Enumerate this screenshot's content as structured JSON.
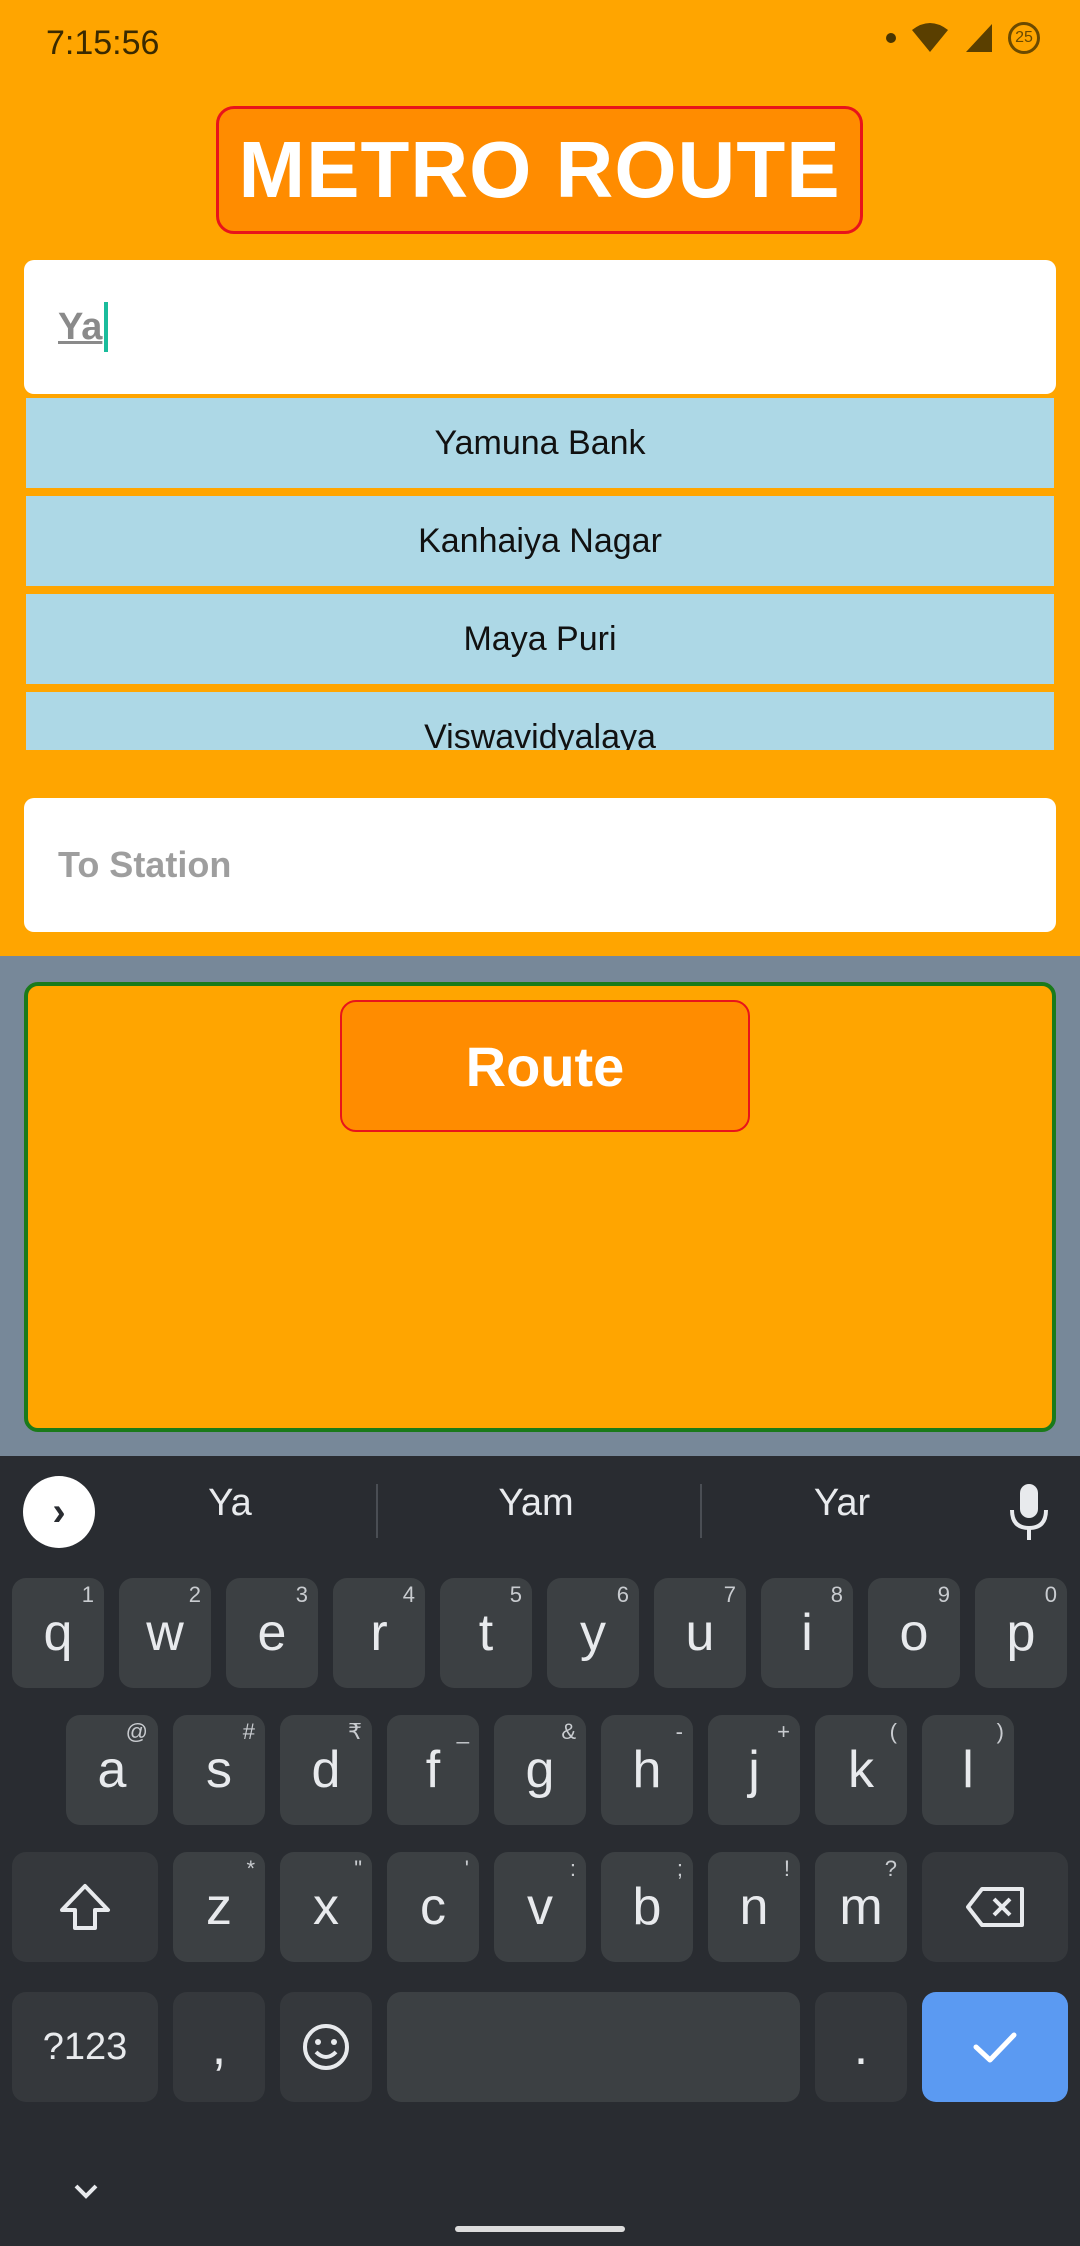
{
  "status": {
    "time": "7:15:56",
    "battery": "25"
  },
  "header": {
    "title": "METRO ROUTE"
  },
  "from_field": {
    "value": "Ya"
  },
  "suggestions": [
    "Yamuna Bank",
    "Kanhaiya Nagar",
    "Maya Puri",
    "Viswavidyalaya"
  ],
  "to_field": {
    "placeholder": "To Station"
  },
  "route_button": {
    "label": "Route"
  },
  "keyboard": {
    "suggestions": [
      "Ya",
      "Yam",
      "Yar"
    ],
    "row1": [
      {
        "k": "q",
        "h": "1"
      },
      {
        "k": "w",
        "h": "2"
      },
      {
        "k": "e",
        "h": "3"
      },
      {
        "k": "r",
        "h": "4"
      },
      {
        "k": "t",
        "h": "5"
      },
      {
        "k": "y",
        "h": "6"
      },
      {
        "k": "u",
        "h": "7"
      },
      {
        "k": "i",
        "h": "8"
      },
      {
        "k": "o",
        "h": "9"
      },
      {
        "k": "p",
        "h": "0"
      }
    ],
    "row2": [
      {
        "k": "a",
        "h": "@"
      },
      {
        "k": "s",
        "h": "#"
      },
      {
        "k": "d",
        "h": "₹"
      },
      {
        "k": "f",
        "h": "_"
      },
      {
        "k": "g",
        "h": "&"
      },
      {
        "k": "h",
        "h": "-"
      },
      {
        "k": "j",
        "h": "+"
      },
      {
        "k": "k",
        "h": "("
      },
      {
        "k": "l",
        "h": ")"
      }
    ],
    "row3": [
      {
        "k": "z",
        "h": "*"
      },
      {
        "k": "x",
        "h": "\""
      },
      {
        "k": "c",
        "h": "'"
      },
      {
        "k": "v",
        "h": ":"
      },
      {
        "k": "b",
        "h": ";"
      },
      {
        "k": "n",
        "h": "!"
      },
      {
        "k": "m",
        "h": "?"
      }
    ],
    "symbols_label": "?123",
    "comma": ",",
    "period": "."
  },
  "colors": {
    "background": "#ffa500",
    "title_fill": "#ff8c00",
    "title_border": "#e8141b",
    "suggestion_fill": "#add8e6",
    "panel": "#778899",
    "panel_border": "#1a7a1a",
    "enter_key": "#5b9af2"
  }
}
